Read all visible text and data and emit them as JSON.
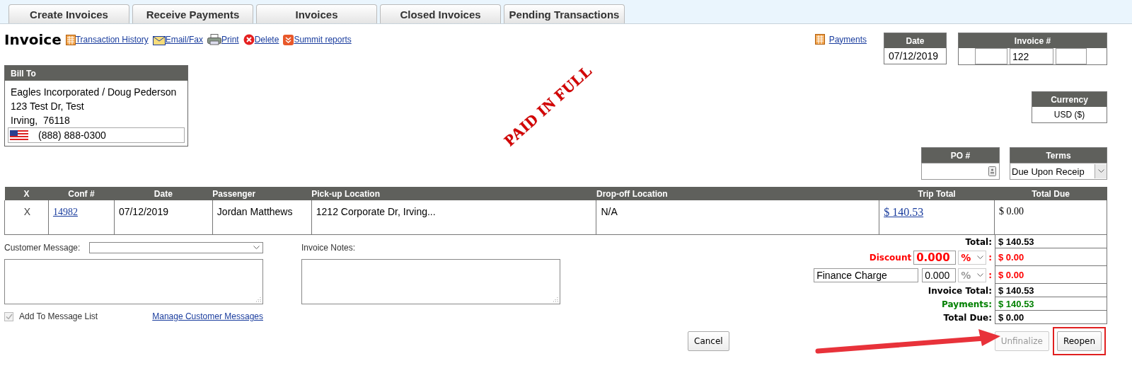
{
  "tabs": [
    {
      "label": "Create Invoices",
      "selected": false
    },
    {
      "label": "Receive Payments",
      "selected": false
    },
    {
      "label": "Invoices",
      "selected": false
    },
    {
      "label": "Closed Invoices",
      "selected": false
    },
    {
      "label": "Pending Transactions",
      "selected": false
    }
  ],
  "toolbar": {
    "title": "Invoice",
    "links": [
      {
        "label": "Transaction History",
        "kind": "ledger"
      },
      {
        "label": "Email/Fax",
        "kind": "mail"
      },
      {
        "label": "Print",
        "kind": "printer"
      },
      {
        "label": "Delete",
        "kind": "delete"
      },
      {
        "label": "Summit reports",
        "kind": "reports"
      }
    ]
  },
  "bill_to": {
    "header": "Bill To",
    "lines": [
      "Eagles Incorporated / Doug Pederson",
      "123 Test Dr, Test",
      "Irving,  76118"
    ],
    "phone": "(888) 888-0300"
  },
  "stamp": "PAID IN FULL",
  "payments_link": "Payments",
  "date": {
    "header": "Date",
    "value": "07/12/2019"
  },
  "invoice_number": {
    "header": "Invoice #",
    "value": "122"
  },
  "currency": {
    "header": "Currency",
    "value": "USD  ($)"
  },
  "po": {
    "header": "PO #"
  },
  "terms": {
    "header": "Terms",
    "value": "Due Upon Receip"
  },
  "table": {
    "columns": [
      "X",
      "Conf #",
      "Date",
      "Passenger",
      "Pick-up Location",
      "Drop-off Location",
      "Trip Total",
      "Total Due"
    ],
    "rows": [
      {
        "x": "X",
        "conf": "14982",
        "date": "07/12/2019",
        "passenger": "Jordan Matthews",
        "pickup": "1212 Corporate Dr, Irving...",
        "dropoff": "N/A",
        "trip_total": "$ 140.53",
        "total_due": "$ 0.00"
      }
    ]
  },
  "customer_message": {
    "label": "Customer Message:"
  },
  "invoice_notes": {
    "label": "Invoice Notes:"
  },
  "add_to_list": {
    "label": "Add To Message List",
    "checked": true,
    "disabled": true
  },
  "manage_link": "Manage Customer Messages",
  "totals": [
    {
      "kind": "plain",
      "label": "Total:",
      "value": "$ 140.53",
      "color": "#000000"
    },
    {
      "kind": "discount",
      "label": "Discount",
      "amount": "0.000",
      "unit": "%",
      "separator": ":",
      "value": "$ 0.00",
      "color": "#ff0000"
    },
    {
      "kind": "charge",
      "name": "Finance Charge",
      "amount": "0.000",
      "unit": "%",
      "separator": ":",
      "value": "$ 0.00",
      "color": "#ff0000"
    },
    {
      "kind": "plain",
      "label": "Invoice Total:",
      "value": "$ 140.53",
      "color": "#000000"
    },
    {
      "kind": "plain",
      "label": "Payments:",
      "value": "$ 140.53",
      "color": "#008000"
    },
    {
      "kind": "plain",
      "label": "Total Due:",
      "value": "$ 0.00",
      "color": "#000000"
    }
  ],
  "buttons": [
    {
      "label": "Cancel",
      "disabled": false,
      "highlighted": false
    },
    {
      "label": "Unfinalize",
      "disabled": true,
      "highlighted": false
    },
    {
      "label": "Reopen",
      "disabled": false,
      "highlighted": true
    }
  ]
}
